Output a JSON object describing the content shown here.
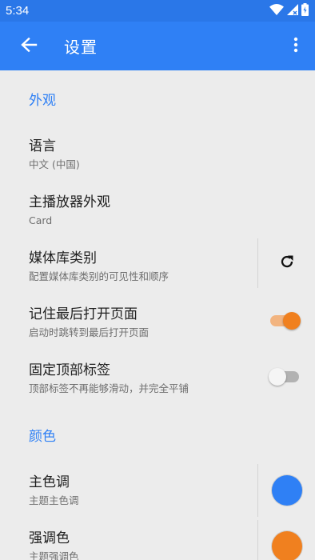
{
  "status_bar": {
    "time": "5:34",
    "icons": [
      "wifi-icon",
      "signal-icon",
      "battery-icon"
    ]
  },
  "app_bar": {
    "title": "设置",
    "back_icon": "arrow-back-icon",
    "more_icon": "more-vert-icon"
  },
  "sections": {
    "appearance": {
      "header": "外观",
      "items": [
        {
          "title": "语言",
          "summary": "中文 (中国)"
        },
        {
          "title": "主播放器外观",
          "summary": "Card"
        },
        {
          "title": "媒体库类别",
          "summary": "配置媒体库类别的可见性和顺序",
          "widget_icon": "refresh-icon"
        },
        {
          "title": "记住最后打开页面",
          "summary": "启动时跳转到最后打开页面",
          "switch_on": true
        },
        {
          "title": "固定顶部标签",
          "summary": "顶部标签不再能够滑动，并完全平铺",
          "switch_on": false
        }
      ]
    },
    "colors": {
      "header": "颜色",
      "items": [
        {
          "title": "主色调",
          "summary": "主题主色调",
          "color": "#2f80f5"
        },
        {
          "title": "强调色",
          "summary": "主题强调色",
          "color": "#f0801f"
        }
      ]
    }
  },
  "colors": {
    "primary": "#2f80f5",
    "status_bar": "#2a77e8",
    "accent": "#f0801f",
    "background": "#ececec"
  }
}
